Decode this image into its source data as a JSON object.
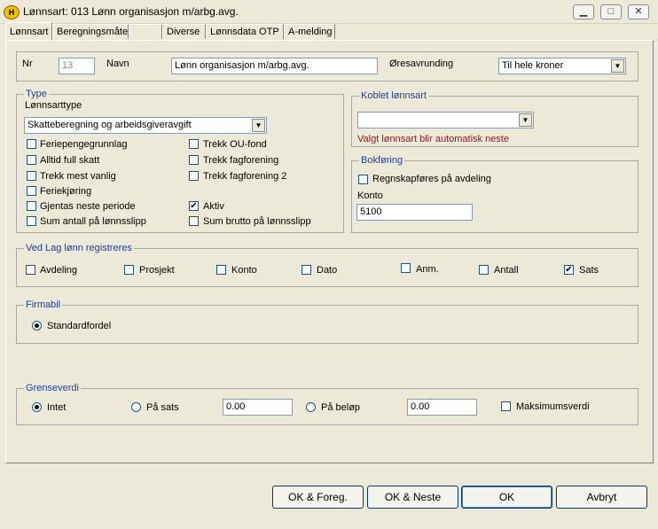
{
  "window": {
    "icon_letter": "H",
    "title": "Lønnsart: 013 Lønn organisasjon  m/arbg.avg."
  },
  "tabs": [
    "Lønnsart",
    "Beregningsmåte",
    "",
    "Diverse",
    "Lønnsdata OTP",
    "A-melding"
  ],
  "header": {
    "nr_label": "Nr",
    "nr_value": "13",
    "navn_label": "Navn",
    "navn_value": "Lønn organisasjon  m/arbg.avg.",
    "oresavrunding_label": "Øresavrunding",
    "oresavrunding_value": "Til hele kroner"
  },
  "type_group": {
    "legend": "Type",
    "lonnsarttype_label": "Lønnsarttype",
    "lonnsarttype_value": "Skatteberegning og arbeidsgiveravgift",
    "left_checks": [
      {
        "label": "Feriepengegrunnlag",
        "checked": false
      },
      {
        "label": "Alltid full skatt",
        "checked": false
      },
      {
        "label": "Trekk mest vanlig",
        "checked": false
      },
      {
        "label": "Feriekjøring",
        "checked": false
      },
      {
        "label": "Gjentas neste periode",
        "checked": false
      },
      {
        "label": "Sum antall på lønnsslipp",
        "checked": false
      }
    ],
    "right_checks": [
      {
        "label": "Trekk OU-fond",
        "checked": false
      },
      {
        "label": "Trekk fagforening",
        "checked": false
      },
      {
        "label": "Trekk fagforening 2",
        "checked": false
      },
      {
        "label": "Aktiv",
        "checked": true
      },
      {
        "label": "Sum brutto på lønnsslipp",
        "checked": false
      }
    ]
  },
  "koblet": {
    "legend": "Koblet lønnsart",
    "value": "",
    "note": "Valgt lønnsart blir automatisk neste"
  },
  "bokforing": {
    "legend": "Bokføring",
    "check_label": "Regnskapføres på avdeling",
    "checked": false,
    "konto_label": "Konto",
    "konto_value": "5100"
  },
  "lag_lonn": {
    "legend": "Ved Lag lønn registreres",
    "checks": [
      {
        "label": "Avdeling",
        "checked": false
      },
      {
        "label": "Prosjekt",
        "checked": false
      },
      {
        "label": "Konto",
        "checked": false
      },
      {
        "label": "Dato",
        "checked": false
      },
      {
        "label": "Anm.",
        "checked": false
      },
      {
        "label": "Antall",
        "checked": false
      },
      {
        "label": "Sats",
        "checked": true
      }
    ]
  },
  "firmabil": {
    "legend": "Firmabil",
    "option": "Standardfordel",
    "selected": true
  },
  "grenseverdi": {
    "legend": "Grenseverdi",
    "intet_label": "Intet",
    "pa_sats_label": "På sats",
    "pa_sats_value": "0.00",
    "pa_belop_label": "På beløp",
    "pa_belop_value": "0.00",
    "maks_label": "Maksimumsverdi",
    "selected": "Intet"
  },
  "buttons": {
    "ok_foreg": "OK & Foreg.",
    "ok_neste": "OK & Neste",
    "ok": "OK",
    "avbryt": "Avbryt"
  },
  "icons": {
    "minimize": "minimize-icon",
    "maximize": "maximize-icon",
    "close": "close-icon",
    "dropdown": "chevron-down-icon"
  }
}
